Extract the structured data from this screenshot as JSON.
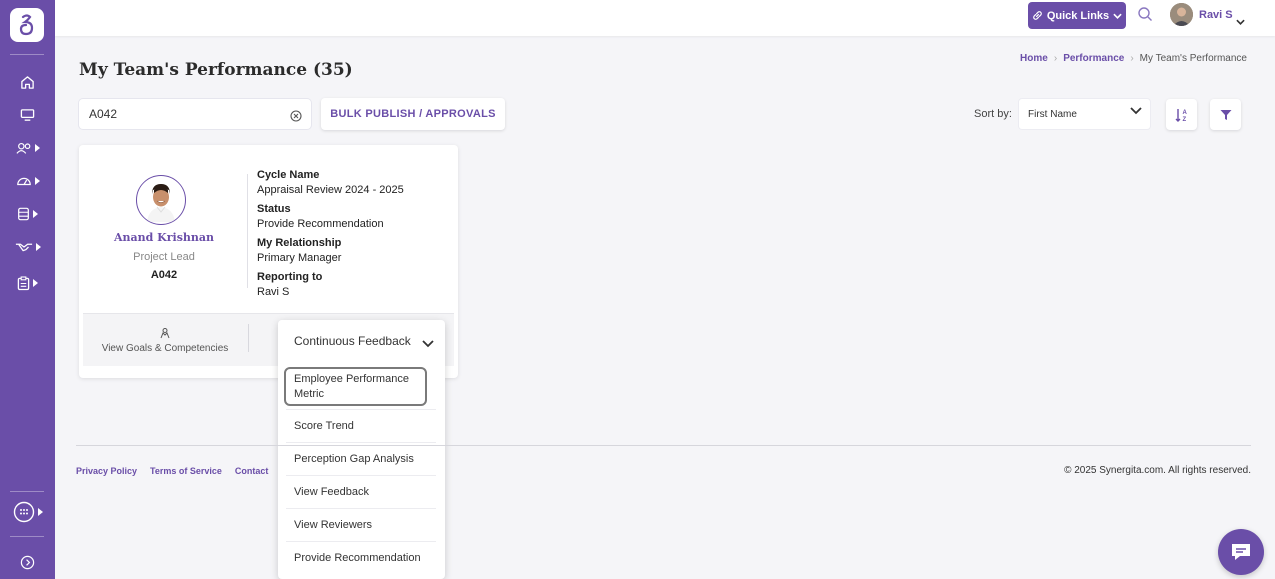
{
  "brand": {
    "accent": "#6a4ea8"
  },
  "header": {
    "quick_links_label": "Quick Links",
    "user_name": "Ravi S"
  },
  "page": {
    "title": "My Team's Performance (35)",
    "breadcrumb": [
      "Home",
      "Performance",
      "My Team's Performance"
    ]
  },
  "toolbar": {
    "search_value": "A042",
    "bulk_button": "BULK PUBLISH / APPROVALS",
    "sort_label": "Sort by:",
    "sort_selected": "First Name"
  },
  "card": {
    "name": "Anand Krishnan",
    "role": "Project Lead",
    "emp_id": "A042",
    "fields": [
      {
        "label": "Cycle Name",
        "value": "Appraisal Review 2024 - 2025"
      },
      {
        "label": "Status",
        "value": "Provide Recommendation"
      },
      {
        "label": "My Relationship",
        "value": "Primary Manager"
      },
      {
        "label": "Reporting to",
        "value": "Ravi S"
      }
    ],
    "goals_link": "View Goals & Competencies"
  },
  "dropdown": {
    "selected": "Continuous Feedback",
    "items": [
      "Employee Performance Metric",
      "Score Trend",
      "Perception Gap Analysis",
      "View Feedback",
      "View Reviewers",
      "Provide Recommendation"
    ]
  },
  "footer": {
    "links": [
      "Privacy Policy",
      "Terms of Service",
      "Contact"
    ],
    "copyright": "© 2025 Synergita.com. All rights reserved."
  },
  "sidebar": {
    "icons": [
      "home-icon",
      "monitor-icon",
      "team-icon",
      "dashboard-icon",
      "database-icon",
      "handshake-icon",
      "clipboard-icon",
      "apps-icon",
      "collapse-icon"
    ]
  }
}
